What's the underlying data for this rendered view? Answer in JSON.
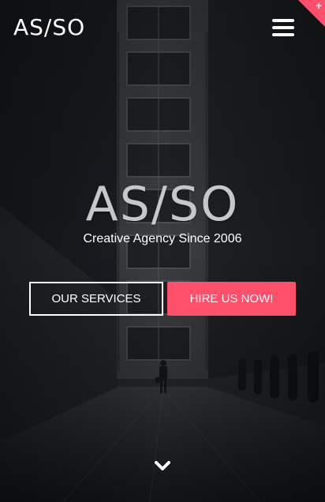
{
  "brand": {
    "logo_text": "AS/SO"
  },
  "hero": {
    "title": "AS/SO",
    "subtitle": "Creative Agency Since 2006"
  },
  "buttons": {
    "services_label": "OUR SERVICES",
    "hire_label": "HIRE US NOW!"
  },
  "corner": {
    "symbol": "+"
  },
  "icons": {
    "menu": "hamburger-menu-icon",
    "scroll": "chevron-down-icon",
    "corner": "plus-icon"
  },
  "colors": {
    "accent": "#ff4f6a",
    "text": "#ffffff",
    "title": "#c7c7c7"
  }
}
